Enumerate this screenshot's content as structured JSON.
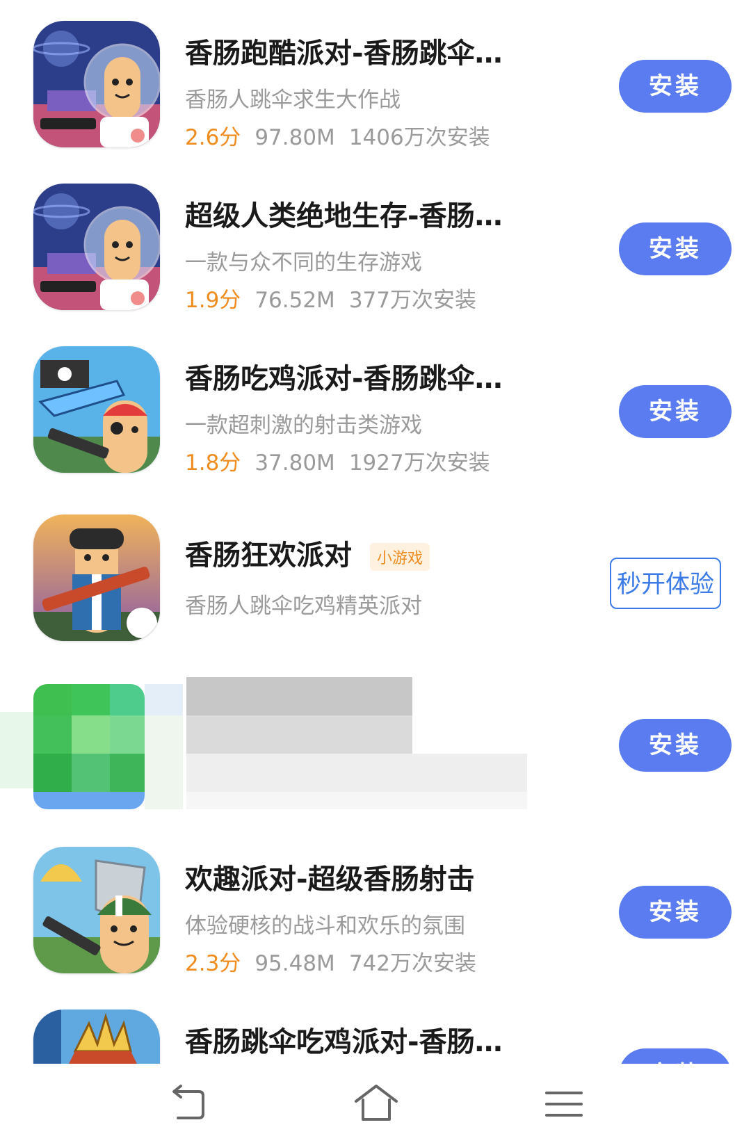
{
  "apps": [
    {
      "title": "香肠跑酷派对-香肠跳伞…",
      "subtitle": "香肠人跳伞求生大作战",
      "rating": "2.6分",
      "size": "97.80M",
      "installs": "1406万次安装",
      "action": "安装",
      "icon": "sausage-astronaut-icon"
    },
    {
      "title": "超级人类绝地生存-香肠…",
      "subtitle": "一款与众不同的生存游戏",
      "rating": "1.9分",
      "size": "76.52M",
      "installs": "377万次安装",
      "action": "安装",
      "icon": "sausage-astronaut-icon"
    },
    {
      "title": "香肠吃鸡派对-香肠跳伞…",
      "subtitle": "一款超刺激的射击类游戏",
      "rating": "1.8分",
      "size": "37.80M",
      "installs": "1927万次安装",
      "action": "安装",
      "icon": "sausage-pirate-icon"
    },
    {
      "title": "香肠狂欢派对",
      "badge": "小游戏",
      "subtitle": "香肠人跳伞吃鸡精英派对",
      "action": "秒开体验",
      "icon": "sausage-gunner-icon"
    },
    {
      "action": "安装",
      "icon": "pixelated-icon"
    },
    {
      "title": "欢趣派对-超级香肠射击",
      "subtitle": "体验硬核的战斗和欢乐的氛围",
      "rating": "2.3分",
      "size": "95.48M",
      "installs": "742万次安装",
      "action": "安装",
      "icon": "sausage-parachute-icon"
    },
    {
      "title": "香肠跳伞吃鸡派对-香肠…",
      "action": "安装",
      "icon": "sausage-crown-icon"
    }
  ],
  "colors": {
    "install_button": "#5b7cf0",
    "rating": "#f08c1e",
    "try_button": "#3a7be8"
  },
  "nav": {
    "back": "back-icon",
    "home": "home-icon",
    "menu": "menu-icon"
  }
}
